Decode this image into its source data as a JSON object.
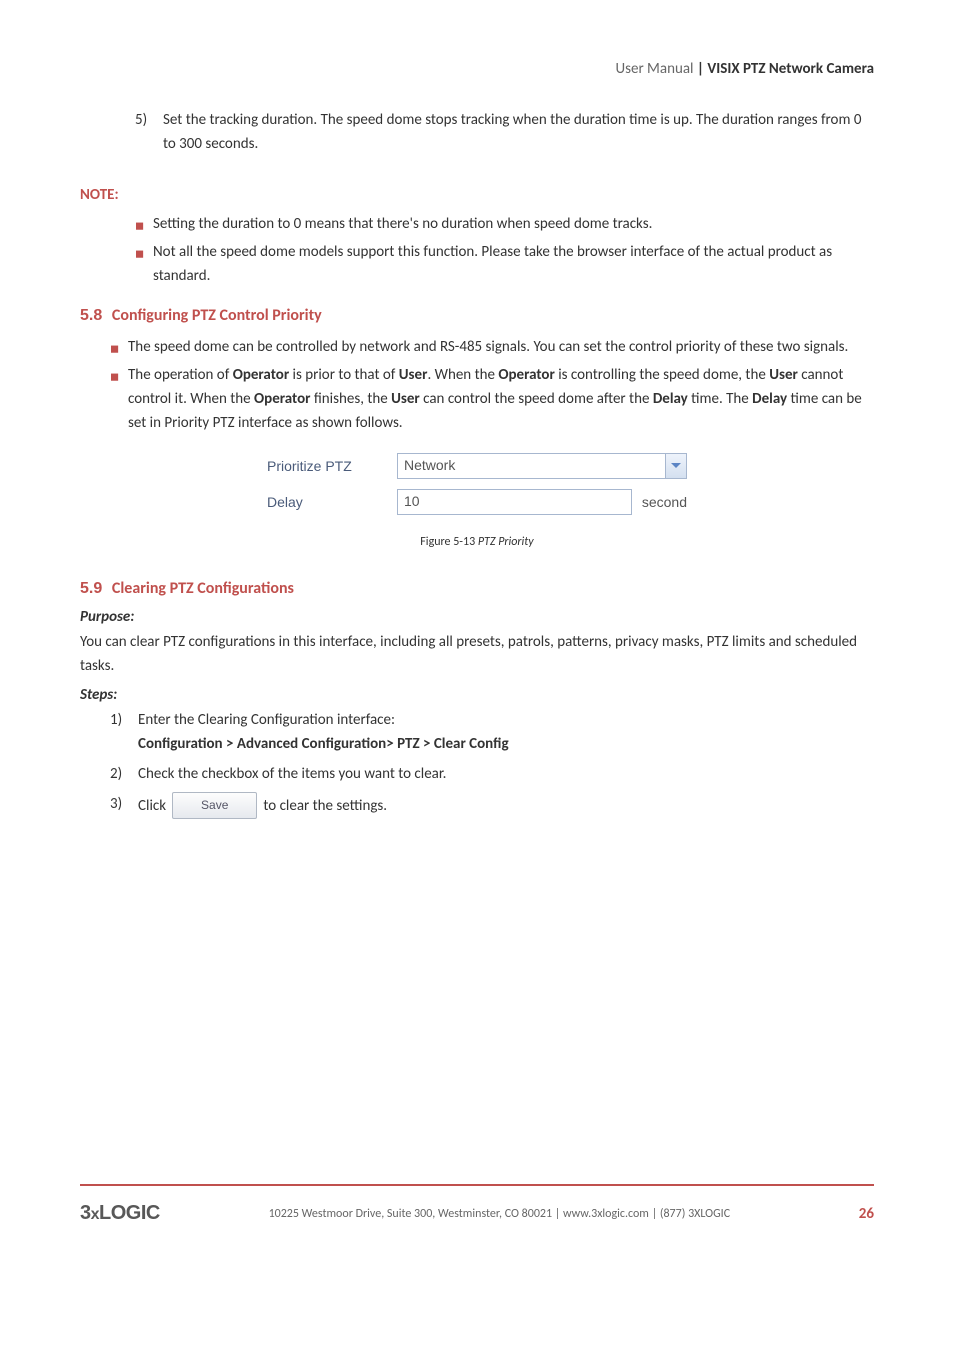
{
  "header": {
    "thin": "User Manual",
    "bold": " | VISIX PTZ Network Camera"
  },
  "step5": {
    "num": "5)",
    "text": "Set the tracking duration. The speed dome stops tracking when the duration time is up. The duration ranges from 0 to 300 seconds."
  },
  "note_label": "NOTE:",
  "note_bullets": [
    "Setting the duration to 0 means that there's no duration when speed dome tracks.",
    "Not all the speed dome models support this function. Please take the browser interface of the actual product as standard."
  ],
  "section58": {
    "num": "5.8",
    "title": " Configuring PTZ Control Priority",
    "bullets": [
      "The speed dome can be controlled by network and RS-485 signals. You can set the control priority of these two signals.",
      "The operation of <b>Operator</b> is prior to that of <b>User</b>. When the <b>Operator</b> is controlling the speed dome, the <b>User</b> cannot control it. When the <b>Operator</b> finishes, the <b>User</b> can control the speed dome after the <b>Delay</b> time. The <b>Delay</b> time can be set in Priority PTZ interface as shown follows."
    ]
  },
  "figure": {
    "prioritize_label": "Prioritize PTZ",
    "prioritize_value": "Network",
    "delay_label": "Delay",
    "delay_value": "10",
    "delay_suffix": "second",
    "caption_prefix": "Figure 5-13 ",
    "caption_italic": "PTZ Priority"
  },
  "section59": {
    "num": "5.9",
    "title": " Clearing PTZ Configurations",
    "purpose_label": "Purpose:",
    "purpose_text": "You can clear PTZ configurations in this interface, including all presets, patrols, patterns, privacy masks, PTZ limits and scheduled tasks.",
    "steps_label": "Steps:",
    "steps": [
      {
        "num": "1)",
        "text": "Enter the Clearing Configuration interface:",
        "path": "Configuration > Advanced Configuration> PTZ > Clear Config"
      },
      {
        "num": "2)",
        "text": "Check the checkbox of the items you want to clear."
      },
      {
        "num": "3)",
        "prefix": "Click ",
        "button": "Save",
        "suffix": " to clear the settings."
      }
    ]
  },
  "footer": {
    "logo_a": "3",
    "logo_x": "x",
    "logo_b": "LOGIC",
    "text": "10225 Westmoor Drive, Suite 300, Westminster, CO 80021 | www.3xlogic.com | (877) 3XLOGIC",
    "page": "26"
  }
}
